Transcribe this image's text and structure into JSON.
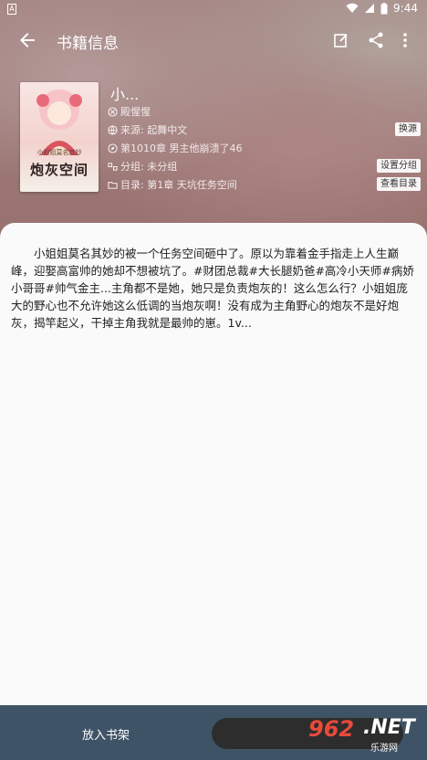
{
  "status_bar": {
    "time": "9:44",
    "app_badge": "A"
  },
  "toolbar": {
    "title": "书籍信息"
  },
  "book": {
    "name": "小...",
    "author": "殿惺惺",
    "source": "来源: 起舞中文",
    "latest": "第1010章 男主他崩溃了46",
    "group": "分组: 未分组",
    "toc": "目录: 第1章 天坑任务空间",
    "cover_title": "炮灰空间",
    "cover_subtitle": "小姐姐莫名其妙"
  },
  "buttons": {
    "change_source": "换源",
    "set_group": "设置分组",
    "view_toc": "查看目录"
  },
  "intro": "小姐姐莫名其妙的被一个任务空间砸中了。原以为靠着金手指走上人生巅峰，迎娶高富帅的她却不想被坑了。#财团总裁#大长腿奶爸#高冷小天师#病娇小哥哥#帅气金主...主角都不是她，她只是负责炮灰的！这么怎么行？小姐姐庞大的野心也不允许她这么低调的当炮灰啊！没有成为主角野心的炮灰不是好炮灰，揭竿起义，干掉主角我就是最帅的崽。1v...",
  "bottom": {
    "add_shelf": "放入书架"
  },
  "watermark": {
    "number": "962",
    "net": ".NET",
    "sub": "乐游网"
  }
}
